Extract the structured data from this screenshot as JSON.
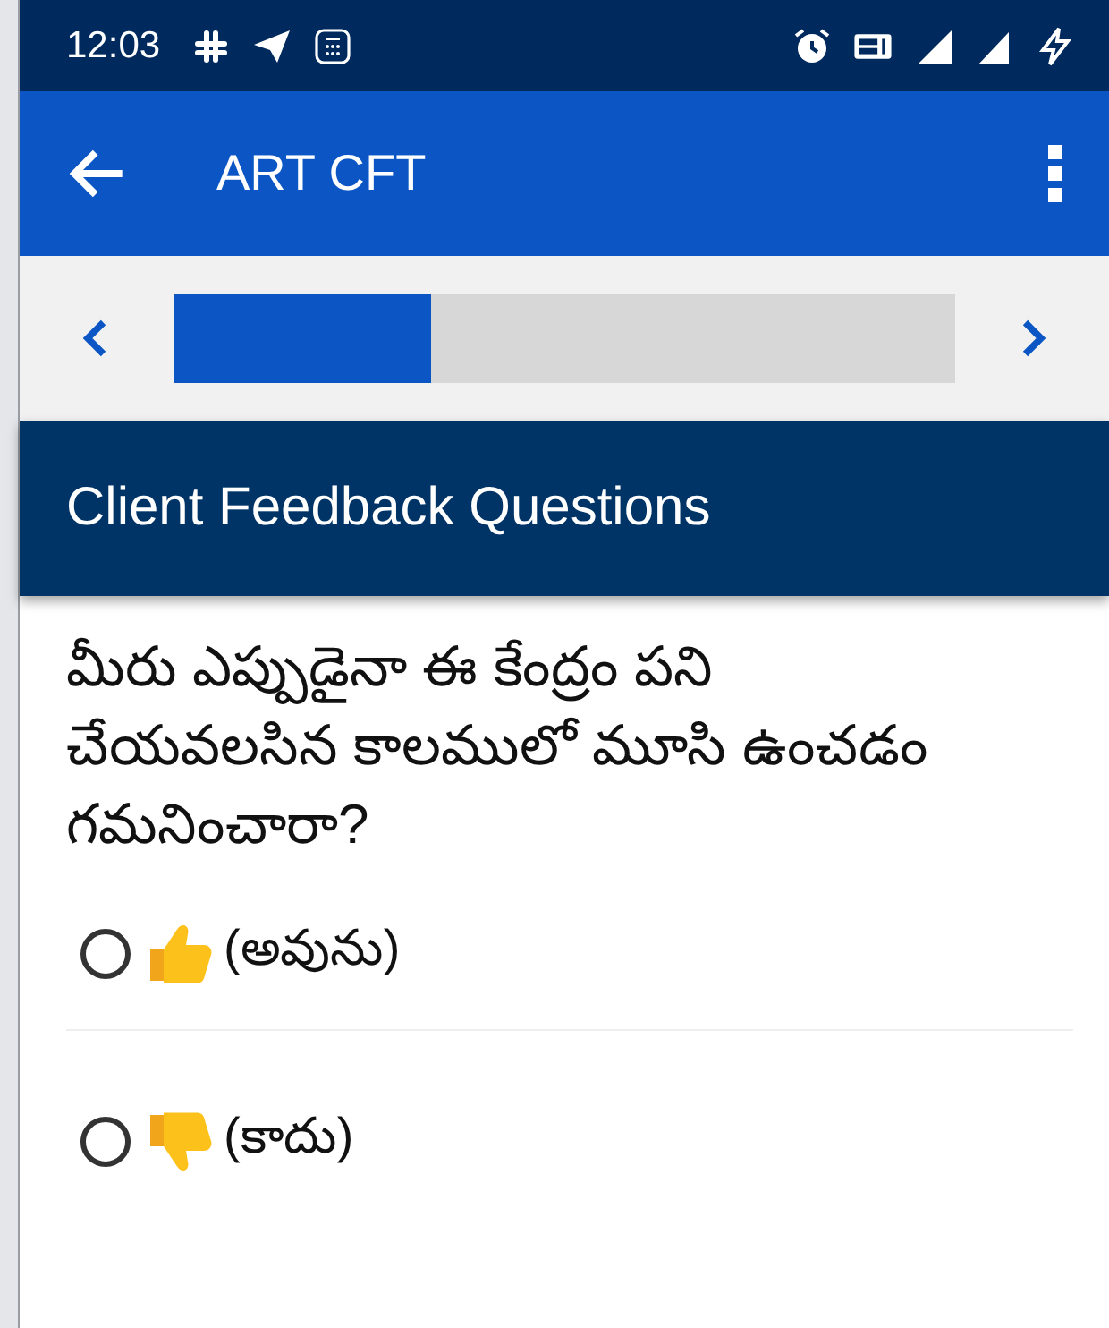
{
  "status_bar": {
    "time": "12:03"
  },
  "app_bar": {
    "title": "ART CFT"
  },
  "progress": {
    "level": 0.33
  },
  "section": {
    "title": "Client Feedback Questions"
  },
  "question": {
    "text": "మీరు ఎప్పుడైనా ఈ కేంద్రం  పని చేయవలసిన కాలములో మూసి ఉంచడం గమనించారా?",
    "options": [
      {
        "kind": "up",
        "label": "(అవును)",
        "selected": false
      },
      {
        "kind": "down",
        "label": "(కాదు)",
        "selected": false
      }
    ]
  }
}
